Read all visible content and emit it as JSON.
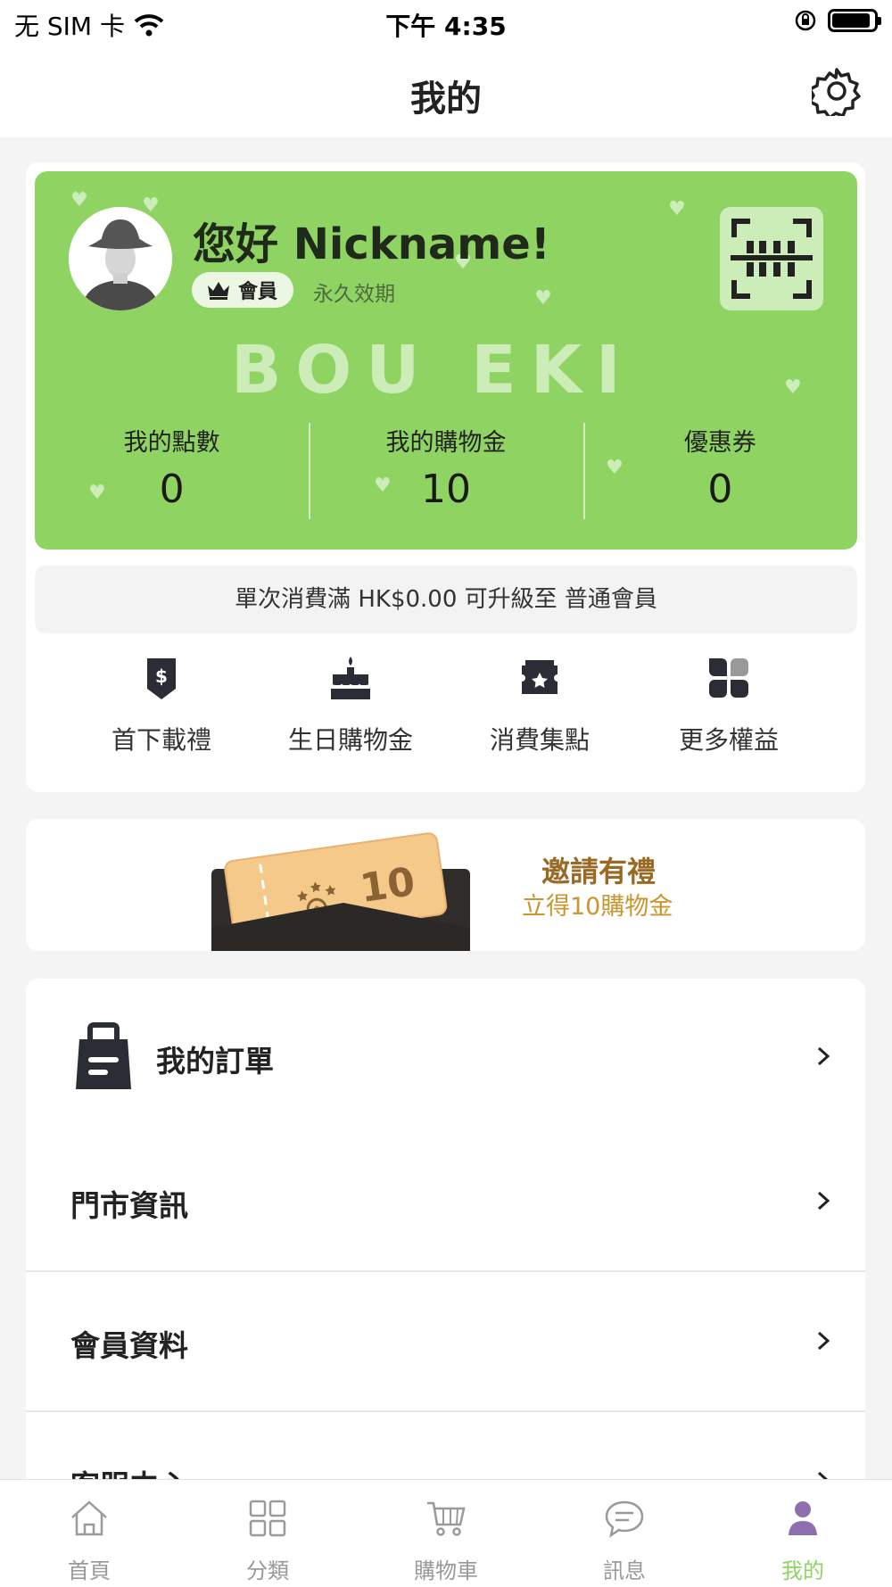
{
  "status_bar": {
    "carrier": "无 SIM 卡",
    "time": "下午 4:35"
  },
  "nav": {
    "title": "我的",
    "settings_icon": "gear-icon"
  },
  "member_card": {
    "greeting": "您好 Nickname!",
    "tier": "會員",
    "validity": "永久效期",
    "watermark": "BOU EKI",
    "card_color": "#8fd462",
    "stats": [
      {
        "label": "我的點數",
        "value": "0"
      },
      {
        "label": "我的購物金",
        "value": "10"
      },
      {
        "label": "優惠券",
        "value": "0"
      }
    ]
  },
  "upgrade_notice": "單次消費滿 HK$0.00 可升級至 普通會員",
  "perks": [
    {
      "label": "首下載禮",
      "icon": "dollar-tag-icon"
    },
    {
      "label": "生日購物金",
      "icon": "cake-icon"
    },
    {
      "label": "消費集點",
      "icon": "star-ticket-icon"
    },
    {
      "label": "更多權益",
      "icon": "clover-icon"
    }
  ],
  "invite": {
    "title": "邀請有禮",
    "subtitle": "立得10購物金",
    "ticket_value": "10"
  },
  "menu": {
    "orders": "我的訂單",
    "rows": [
      "門市資訊",
      "會員資料",
      "客服中心"
    ]
  },
  "tab_bar": [
    {
      "label": "首頁",
      "icon": "home-icon"
    },
    {
      "label": "分類",
      "icon": "grid-icon"
    },
    {
      "label": "購物車",
      "icon": "cart-icon"
    },
    {
      "label": "訊息",
      "icon": "chat-icon"
    },
    {
      "label": "我的",
      "icon": "person-icon",
      "active": true
    }
  ],
  "colors": {
    "accent": "#8fd462",
    "invite_title": "#9a6a25",
    "invite_sub": "#c9952f"
  }
}
